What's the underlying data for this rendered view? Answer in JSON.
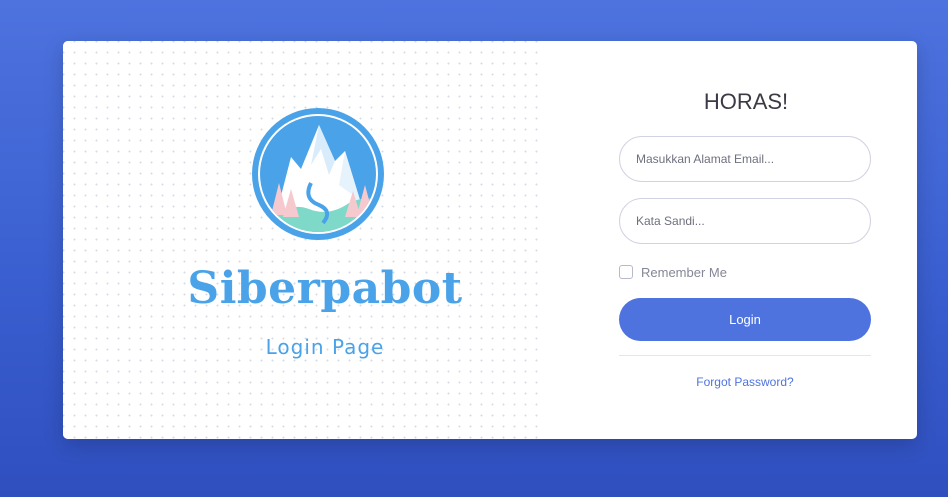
{
  "brand": {
    "title": "Siberpabot",
    "subtitle": "Login Page",
    "logo_icon": "mountain-landscape-logo-icon"
  },
  "login": {
    "greeting": "HORAS!",
    "email_placeholder": "Masukkan Alamat Email...",
    "password_placeholder": "Kata Sandi...",
    "remember_label": "Remember Me",
    "remember_checked": false,
    "button_label": "Login",
    "forgot_label": "Forgot Password?"
  },
  "colors": {
    "background": "#4e73df",
    "primary": "#4e73df",
    "brand_text": "#4aa3e8"
  }
}
